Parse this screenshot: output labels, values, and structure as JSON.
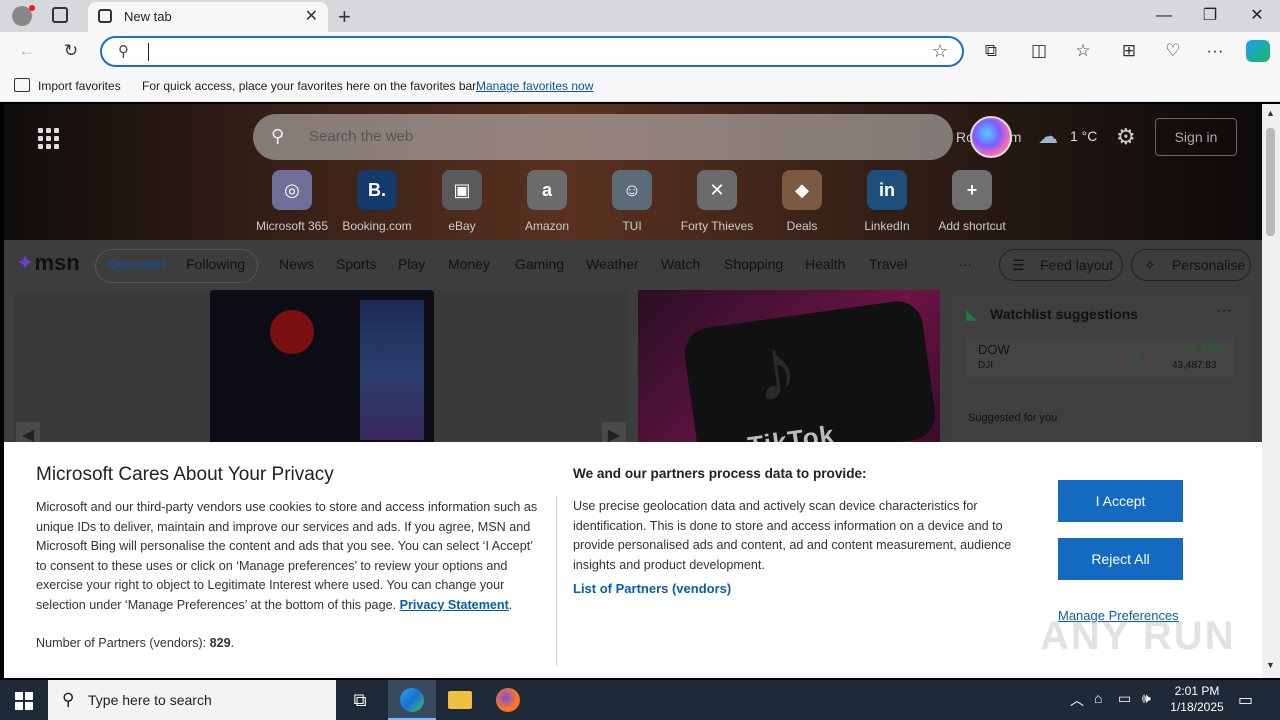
{
  "browser": {
    "tab_title": "New tab",
    "address_value": "",
    "favorites_bar": {
      "import_label": "Import favorites",
      "hint": "For quick access, place your favorites here on the favorites bar.",
      "manage_link": "Manage favorites now"
    }
  },
  "msn": {
    "search_placeholder": "Search the web",
    "location": "Rotterdam",
    "temperature": "1 °C",
    "sign_in": "Sign in",
    "shortcuts": [
      {
        "label": "Microsoft 365",
        "glyph": "◎",
        "color": "#6f6f9a"
      },
      {
        "label": "Booking.com",
        "glyph": "B.",
        "color": "#143a6b"
      },
      {
        "label": "eBay",
        "glyph": "▣",
        "color": "#5a5a5a"
      },
      {
        "label": "Amazon",
        "glyph": "a",
        "color": "#6b6b6b"
      },
      {
        "label": "TUI",
        "glyph": "☺",
        "color": "#5c6b78"
      },
      {
        "label": "Forty Thieves",
        "glyph": "✕",
        "color": "#6b6b6b"
      },
      {
        "label": "Deals",
        "glyph": "◆",
        "color": "#7a5a40"
      },
      {
        "label": "LinkedIn",
        "glyph": "in",
        "color": "#1d4f7a"
      },
      {
        "label": "Add shortcut",
        "glyph": "+",
        "color": "#6f6f6f"
      }
    ],
    "logo": "msn",
    "feed_tabs": [
      "Discover",
      "Following"
    ],
    "nav": [
      "News",
      "Sports",
      "Play",
      "Money",
      "Gaming",
      "Weather",
      "Watch",
      "Shopping",
      "Health",
      "Travel"
    ],
    "more": "···",
    "feed_layout": "Feed layout",
    "personalise": "Personalise",
    "watchlist": {
      "title": "Watchlist suggestions",
      "ticker": "DOW",
      "sub": "DJI",
      "change": "+0.78%",
      "price": "43,487.83",
      "suggested": "Suggested for you"
    },
    "tiktok_word": "TikTok"
  },
  "privacy": {
    "title": "Microsoft Cares About Your Privacy",
    "body": "Microsoft and our third-party vendors use cookies to store and access information such as unique IDs to deliver, maintain and improve our services and ads. If you agree, MSN and Microsoft Bing will personalise the content and ads that you see. You can select ‘I Accept’ to consent to these uses or click on ‘Manage preferences’ to review your options and exercise your right to object to Legitimate Interest where used.  You can change your selection under ‘Manage Preferences’ at the bottom of this page.",
    "privacy_link": "Privacy Statement",
    "partners_count_label": "Number of Partners (vendors):",
    "partners_count": "829",
    "process_title": "We and our partners process data to provide:",
    "process_body": "Use precise geolocation data and actively scan device characteristics for identification. This is done to store and access information on a device and to provide personalised ads and content, ad and content measurement, audience insights and product development.",
    "partners_link": "List of Partners (vendors)",
    "accept": "I Accept",
    "reject": "Reject All",
    "manage": "Manage Preferences"
  },
  "taskbar": {
    "search_placeholder": "Type here to search",
    "time": "2:01 PM",
    "date": "1/18/2025"
  },
  "watermark": "ANY RUN"
}
